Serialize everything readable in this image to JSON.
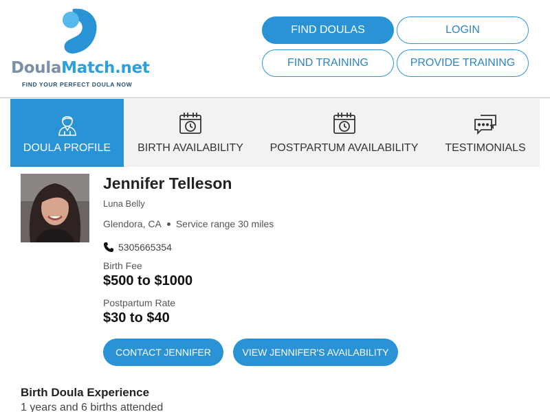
{
  "logo": {
    "name_part1": "Doula",
    "name_part2": "Match.net",
    "tagline": "FIND YOUR PERFECT DOULA NOW",
    "colors": {
      "light_blue": "#55b9ee",
      "blue": "#2a93d6",
      "gray": "#7d8fa6"
    }
  },
  "nav": {
    "find_doulas": "FIND DOULAS",
    "login": "LOGIN",
    "find_training": "FIND TRAINING",
    "provide_training": "PROVIDE TRAINING"
  },
  "tabs": [
    {
      "label": "DOULA PROFILE",
      "icon": "doula-person-icon",
      "active": true
    },
    {
      "label": "BIRTH AVAILABILITY",
      "icon": "calendar-clock-icon",
      "active": false
    },
    {
      "label": "POSTPARTUM AVAILABILITY",
      "icon": "calendar-clock-icon",
      "active": false
    },
    {
      "label": "TESTIMONIALS",
      "icon": "chat-bubbles-icon",
      "active": false
    }
  ],
  "profile": {
    "name": "Jennifer Telleson",
    "business": "Luna Belly",
    "location": "Glendora, CA",
    "service_range": "Service range 30 miles",
    "phone": "5305665354",
    "birth_fee_label": "Birth Fee",
    "birth_fee": "$500 to $1000",
    "postpartum_label": "Postpartum Rate",
    "postpartum_rate": "$30 to $40",
    "contact_button": "CONTACT JENNIFER",
    "availability_button": "VIEW JENNIFER'S AVAILABILITY"
  },
  "experience": {
    "title": "Birth Doula Experience",
    "text": "1 years and 6 births attended"
  },
  "colors": {
    "accent": "#2a93d6",
    "tab_bg": "#f2f2f2"
  }
}
